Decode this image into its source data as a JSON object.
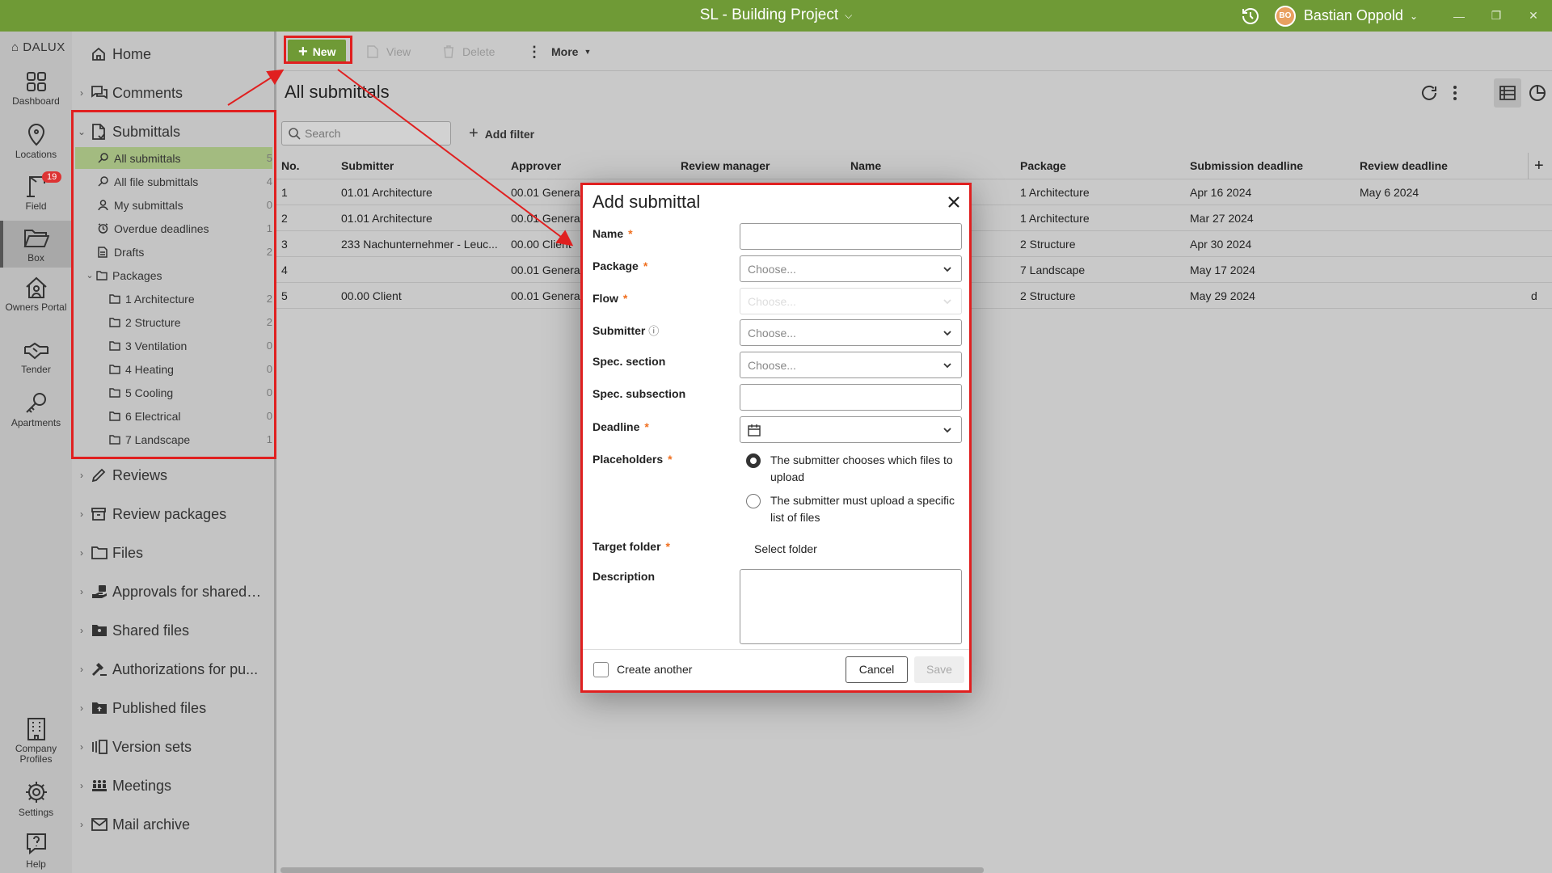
{
  "titlebar": {
    "project": "SL - Building Project",
    "user_initials": "BO",
    "user_name": "Bastian Oppold"
  },
  "rail": {
    "logo": "DALUX",
    "items": [
      {
        "label": "Dashboard",
        "icon": "grid-icon"
      },
      {
        "label": "Locations",
        "icon": "location-pin-icon"
      },
      {
        "label": "Field",
        "icon": "crane-icon",
        "badge": "19"
      },
      {
        "label": "Box",
        "icon": "folder-open-icon"
      },
      {
        "label": "Owners Portal",
        "icon": "house-user-icon"
      },
      {
        "label": "Tender",
        "icon": "handshake-icon"
      },
      {
        "label": "Apartments",
        "icon": "key-icon"
      },
      {
        "label": "Company Profiles",
        "icon": "building-icon"
      },
      {
        "label": "Settings",
        "icon": "gear-icon"
      },
      {
        "label": "Help",
        "icon": "help-icon"
      }
    ]
  },
  "nav": {
    "home": "Home",
    "comments": "Comments",
    "submittals": "Submittals",
    "submittal_items": [
      {
        "label": "All submittals",
        "count": "5"
      },
      {
        "label": "All file submittals",
        "count": "4"
      },
      {
        "label": "My submittals",
        "count": "0"
      },
      {
        "label": "Overdue deadlines",
        "count": "1"
      },
      {
        "label": "Drafts",
        "count": "2"
      },
      {
        "label": "Packages",
        "count": ""
      }
    ],
    "packages": [
      {
        "label": "1 Architecture",
        "count": "2"
      },
      {
        "label": "2 Structure",
        "count": "2"
      },
      {
        "label": "3 Ventilation",
        "count": "0"
      },
      {
        "label": "4 Heating",
        "count": "0"
      },
      {
        "label": "5 Cooling",
        "count": "0"
      },
      {
        "label": "6 Electrical",
        "count": "0"
      },
      {
        "label": "7 Landscape",
        "count": "1"
      }
    ],
    "sections": [
      "Reviews",
      "Review packages",
      "Files",
      "Approvals for shared ...",
      "Shared files",
      "Authorizations for pu...",
      "Published files",
      "Version sets",
      "Meetings",
      "Mail archive"
    ]
  },
  "toolbar": {
    "new": "New",
    "view": "View",
    "delete": "Delete",
    "more": "More"
  },
  "main": {
    "title": "All submittals",
    "search_placeholder": "Search",
    "add_filter": "Add filter"
  },
  "grid": {
    "headers": [
      "No.",
      "Submitter",
      "Approver",
      "Review manager",
      "Name",
      "Package",
      "Submission deadline",
      "Review deadline"
    ],
    "rows": [
      [
        "1",
        "01.01 Architecture",
        "00.01 General",
        "",
        "",
        "1 Architecture",
        "Apr 16 2024",
        "May 6 2024",
        ""
      ],
      [
        "2",
        "01.01 Architecture",
        "00.01 General",
        "",
        "",
        "1 Architecture",
        "Mar 27 2024",
        "",
        ""
      ],
      [
        "3",
        "233 Nachunternehmer - Leuc...",
        "00.00 Client",
        "",
        "",
        "2 Structure",
        "Apr 30 2024",
        "",
        ""
      ],
      [
        "4",
        "",
        "00.01 General",
        "",
        "",
        "7 Landscape",
        "May 17 2024",
        "",
        ""
      ],
      [
        "5",
        "00.00 Client",
        "00.01 General",
        "",
        "",
        "2 Structure",
        "May 29 2024",
        "",
        "d"
      ]
    ]
  },
  "modal": {
    "title": "Add submittal",
    "labels": {
      "name": "Name",
      "package": "Package",
      "flow": "Flow",
      "submitter": "Submitter",
      "spec_section": "Spec. section",
      "spec_subsection": "Spec. subsection",
      "deadline": "Deadline",
      "placeholders": "Placeholders",
      "target_folder": "Target folder",
      "description": "Description"
    },
    "required_mark": "*",
    "choose": "Choose...",
    "radio_1": "The submitter chooses which files to upload",
    "radio_2": "The submitter must upload a specific list of files",
    "select_folder": "Select folder",
    "create_another": "Create another",
    "cancel": "Cancel",
    "save": "Save"
  },
  "colors": {
    "brand_green": "#6f9a36",
    "highlight_red": "#e02020",
    "required_orange": "#f07020"
  }
}
